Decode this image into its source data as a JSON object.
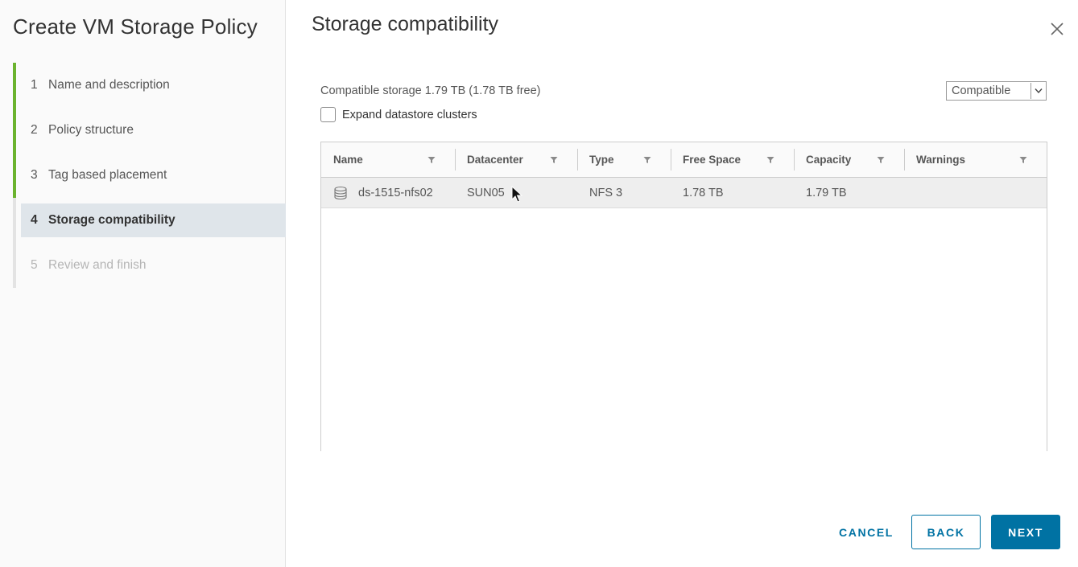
{
  "wizard": {
    "title": "Create VM Storage Policy",
    "steps": [
      {
        "num": "1",
        "label": "Name and description",
        "state": "done"
      },
      {
        "num": "2",
        "label": "Policy structure",
        "state": "done"
      },
      {
        "num": "3",
        "label": "Tag based placement",
        "state": "done"
      },
      {
        "num": "4",
        "label": "Storage compatibility",
        "state": "active"
      },
      {
        "num": "5",
        "label": "Review and finish",
        "state": "pending"
      }
    ]
  },
  "page": {
    "title": "Storage compatibility",
    "summary": "Compatible storage 1.79 TB (1.78 TB free)",
    "filter_select": {
      "selected": "Compatible"
    },
    "expand_label": "Expand datastore clusters",
    "expand_checked": false
  },
  "grid": {
    "columns": [
      "Name",
      "Datacenter",
      "Type",
      "Free Space",
      "Capacity",
      "Warnings"
    ],
    "rows": [
      {
        "name": "ds-1515-nfs02",
        "datacenter": "SUN05",
        "type": "NFS 3",
        "free_space": "1.78 TB",
        "capacity": "1.79 TB",
        "warnings": ""
      }
    ]
  },
  "footer": {
    "cancel": "CANCEL",
    "back": "BACK",
    "next": "NEXT"
  },
  "colors": {
    "accent": "#0072a3",
    "done_bar": "#6bb32e",
    "active_bg": "#dfe5ea"
  }
}
